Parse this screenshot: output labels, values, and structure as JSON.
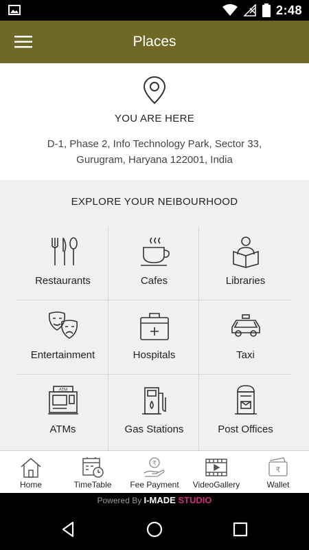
{
  "status_bar": {
    "time": "2:48",
    "icons": [
      "image-icon",
      "wifi-icon",
      "no-signal-icon",
      "battery-icon"
    ]
  },
  "app_bar": {
    "title": "Places",
    "menu_icon": "hamburger-menu-icon"
  },
  "location": {
    "icon": "location-pin-icon",
    "label": "YOU ARE HERE",
    "address_line1": "D-1, Phase 2, Info Technology Park, Sector 33,",
    "address_line2": "Gurugram, Haryana 122001, India"
  },
  "explore": {
    "heading": "EXPLORE YOUR NEIBOURHOOD",
    "categories": [
      {
        "label": "Restaurants",
        "icon": "cutlery-icon"
      },
      {
        "label": "Cafes",
        "icon": "coffee-cup-icon"
      },
      {
        "label": "Libraries",
        "icon": "reader-book-icon"
      },
      {
        "label": "Entertainment",
        "icon": "theatre-masks-icon"
      },
      {
        "label": "Hospitals",
        "icon": "first-aid-kit-icon"
      },
      {
        "label": "Taxi",
        "icon": "taxi-car-icon"
      },
      {
        "label": "ATMs",
        "icon": "atm-machine-icon"
      },
      {
        "label": "Gas Stations",
        "icon": "fuel-pump-icon"
      },
      {
        "label": "Post Offices",
        "icon": "post-box-icon"
      }
    ]
  },
  "bottom_nav": {
    "items": [
      {
        "label": "Home",
        "icon": "home-icon"
      },
      {
        "label": "TimeTable",
        "icon": "calendar-clock-icon"
      },
      {
        "label": "Fee Payment",
        "icon": "rupee-hand-icon"
      },
      {
        "label": "VideoGallery",
        "icon": "film-play-icon"
      },
      {
        "label": "Wallet",
        "icon": "wallet-rupee-icon"
      }
    ]
  },
  "footer": {
    "powered_by": "Powered By",
    "brand_part1": "I-MADE",
    "brand_part2": " STUDIO"
  },
  "system_nav": {
    "icons": [
      "back-icon",
      "home-circle-icon",
      "recents-icon"
    ]
  },
  "colors": {
    "app_bar": "#6f6826",
    "brand_accent": "#d02c7a"
  }
}
